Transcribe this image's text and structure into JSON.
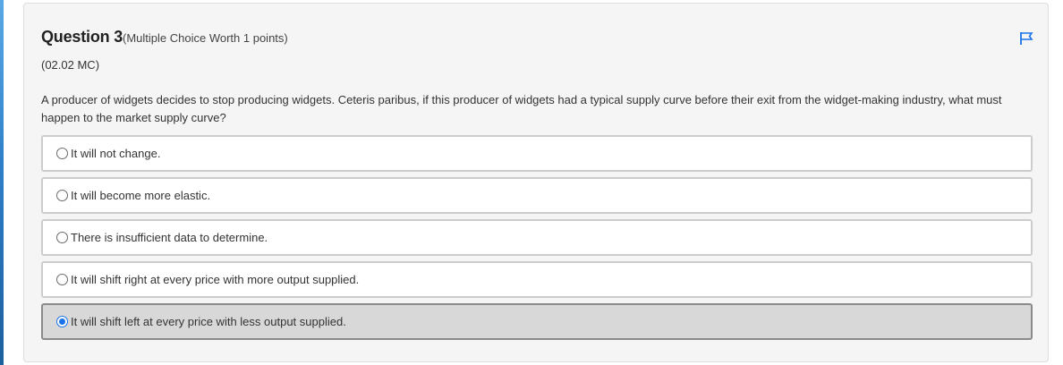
{
  "question": {
    "title": "Question 3",
    "worth": "(Multiple Choice Worth 1 points)",
    "code": "(02.02 MC)",
    "text": "A producer of widgets decides to stop producing widgets. Ceteris paribus, if this producer of widgets had a typical supply curve before their exit from the widget-making industry, what must happen to the market supply curve?"
  },
  "icons": {
    "flag": "flag-icon"
  },
  "colors": {
    "accent": "#1a73e8",
    "selected_background": "#d8d8d8"
  },
  "options": [
    {
      "label": "It will not change.",
      "selected": false
    },
    {
      "label": "It will become more elastic.",
      "selected": false
    },
    {
      "label": "There is insufficient data to determine.",
      "selected": false
    },
    {
      "label": "It will shift right at every price with more output supplied.",
      "selected": false
    },
    {
      "label": "It will shift left at every price with less output supplied.",
      "selected": true
    }
  ]
}
